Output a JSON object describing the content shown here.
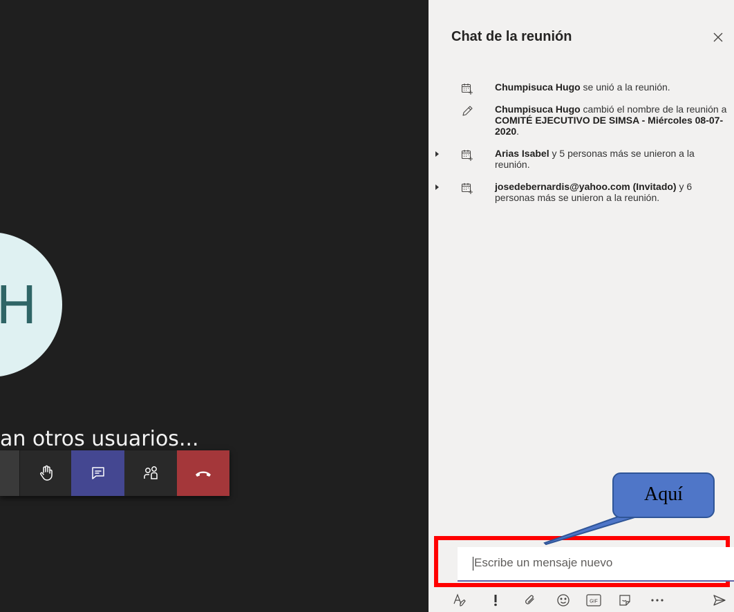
{
  "stage": {
    "avatar_initial": "H",
    "waiting_text": "an otros usuarios..."
  },
  "toolbar": {
    "buttons": [
      {
        "name": "raise-hand",
        "icon": "hand-icon"
      },
      {
        "name": "show-chat",
        "icon": "chat-icon",
        "active": true
      },
      {
        "name": "participants",
        "icon": "people-icon"
      },
      {
        "name": "hang-up",
        "icon": "phone-hangup-icon"
      }
    ]
  },
  "chat": {
    "title": "Chat de la reunión",
    "events": [
      {
        "icon": "calendar-join-icon",
        "bold": "Chumpisuca Hugo",
        "text": " se unió a la reunión.",
        "caret": false
      },
      {
        "icon": "pencil-icon",
        "bold": "Chumpisuca Hugo",
        "text": " cambió el nombre de la reunión a ",
        "bold2": "COMITÉ EJECUTIVO DE SIMSA - Miércoles 08-07-2020",
        "text2": ".",
        "caret": false
      },
      {
        "icon": "calendar-join-icon",
        "bold": "Arias Isabel",
        "text": " y 5 personas más se unieron a la reunión.",
        "caret": true
      },
      {
        "icon": "calendar-join-icon",
        "bold": "josedebernardis@yahoo.com (Invitado)",
        "text": " y 6 personas más se unieron a la reunión.",
        "caret": true
      }
    ],
    "compose_placeholder": "Escribe un mensaje nuevo",
    "format_icons": [
      "format-icon",
      "important-icon",
      "attach-icon",
      "emoji-icon",
      "gif-icon",
      "sticker-icon",
      "more-icon",
      "send-icon"
    ]
  },
  "annotation": {
    "callout_text": "Aquí",
    "highlight_color": "#ff0000"
  }
}
